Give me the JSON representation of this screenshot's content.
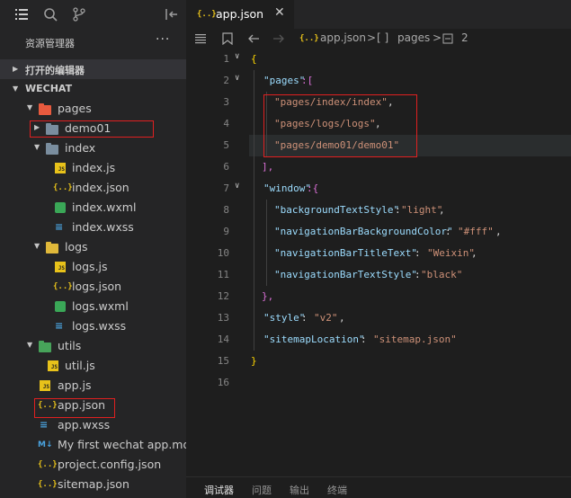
{
  "activity_bar": {
    "icons": [
      "explorer-icon",
      "search-icon",
      "source-control-icon",
      "collapse-panel-icon"
    ]
  },
  "explorer": {
    "title": "资源管理器",
    "more": "···",
    "open_editors": "打开的编辑器",
    "workspace": "WECHAT",
    "tree": [
      {
        "name": "pages",
        "type": "folder",
        "color": "#e85a3e"
      },
      {
        "name": "demo01",
        "type": "folder",
        "color": "#7a8d9e"
      },
      {
        "name": "index",
        "type": "folder",
        "color": "#7a8d9e"
      },
      {
        "name": "index.js",
        "type": "js"
      },
      {
        "name": "index.json",
        "type": "json"
      },
      {
        "name": "index.wxml",
        "type": "wxml"
      },
      {
        "name": "index.wxss",
        "type": "wxss"
      },
      {
        "name": "logs",
        "type": "folder",
        "color": "#e0b83a"
      },
      {
        "name": "logs.js",
        "type": "js"
      },
      {
        "name": "logs.json",
        "type": "json"
      },
      {
        "name": "logs.wxml",
        "type": "wxml"
      },
      {
        "name": "logs.wxss",
        "type": "wxss"
      },
      {
        "name": "utils",
        "type": "folder",
        "color": "#47a35a"
      },
      {
        "name": "util.js",
        "type": "js"
      },
      {
        "name": "app.js",
        "type": "js"
      },
      {
        "name": "app.json",
        "type": "json"
      },
      {
        "name": "app.wxss",
        "type": "wxss"
      },
      {
        "name": "My first wechat app.md",
        "type": "md"
      },
      {
        "name": "project.config.json",
        "type": "json"
      },
      {
        "name": "sitemap.json",
        "type": "json"
      }
    ]
  },
  "editor": {
    "tab_icon": "{..}",
    "tab_label": "app.json",
    "tab_close": "✕",
    "breadcrumb": {
      "file_icon": "{..}",
      "file": "app.json",
      "sep": ">",
      "array_icon": "[ ]",
      "key": "pages",
      "index": "2"
    },
    "line_numbers": [
      "1",
      "2",
      "3",
      "4",
      "5",
      "6",
      "7",
      "8",
      "9",
      "10",
      "11",
      "12",
      "13",
      "14",
      "15",
      "16"
    ],
    "code": {
      "l1": "{",
      "l2_key": "\"pages\"",
      "l2_rest": ":[",
      "l3": "\"pages/index/index\"",
      "l3_comma": ",",
      "l4": "\"pages/logs/logs\"",
      "l4_comma": ",",
      "l5": "\"pages/demo01/demo01\"",
      "l6": "],",
      "l7_key": "\"window\"",
      "l7_rest": ":{",
      "l8_key": "\"backgroundTextStyle\"",
      "l8_colon": ":",
      "l8_val": "\"light\"",
      "l8_comma": ",",
      "l9_key": "\"navigationBarBackgroundColor\"",
      "l9_colon": ": ",
      "l9_val": "\"#fff\"",
      "l9_comma": ",",
      "l10_key": "\"navigationBarTitleText\"",
      "l10_colon": ": ",
      "l10_val": "\"Weixin\"",
      "l10_comma": ",",
      "l11_key": "\"navigationBarTextStyle\"",
      "l11_colon": ":",
      "l11_val": "\"black\"",
      "l12": "},",
      "l13_key": "\"style\"",
      "l13_colon": ": ",
      "l13_val": "\"v2\"",
      "l13_comma": ",",
      "l14_key": "\"sitemapLocation\"",
      "l14_colon": ": ",
      "l14_val": "\"sitemap.json\"",
      "l15": "}"
    }
  },
  "bottom_panel": {
    "tabs": [
      "调试器",
      "问题",
      "输出",
      "终端"
    ]
  }
}
